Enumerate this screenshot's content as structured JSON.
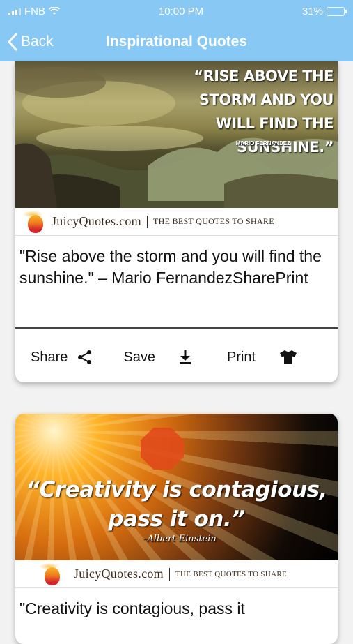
{
  "status": {
    "carrier": "FNB",
    "time": "10:00 PM",
    "battery": "31%",
    "battery_level": 0.31,
    "battery_color": "#f7d21a"
  },
  "nav": {
    "back_label": "Back",
    "title": "Inspirational Quotes",
    "bar_color": "#87c8f4"
  },
  "brand": {
    "name": "JuicyQuotes.com",
    "tagline": "THE BEST QUOTES TO SHARE"
  },
  "cards": [
    {
      "image_quote": "“RISE ABOVE THE STORM AND YOU WILL FIND THE SUNSHINE.”",
      "image_author": "MARIO FERNANDEZ",
      "text": "\"Rise above the storm and you will find the sunshine.\" – Mario FernandezSharePrint",
      "actions": {
        "share": "Share",
        "save": "Save",
        "print": "Print"
      },
      "icons": [
        "share-icon",
        "download-icon",
        "tshirt-icon"
      ]
    },
    {
      "image_quote": "“Creativity is contagious, pass it on.”",
      "image_author": "–Albert Einstein",
      "text": "\"Creativity is contagious, pass it"
    }
  ]
}
